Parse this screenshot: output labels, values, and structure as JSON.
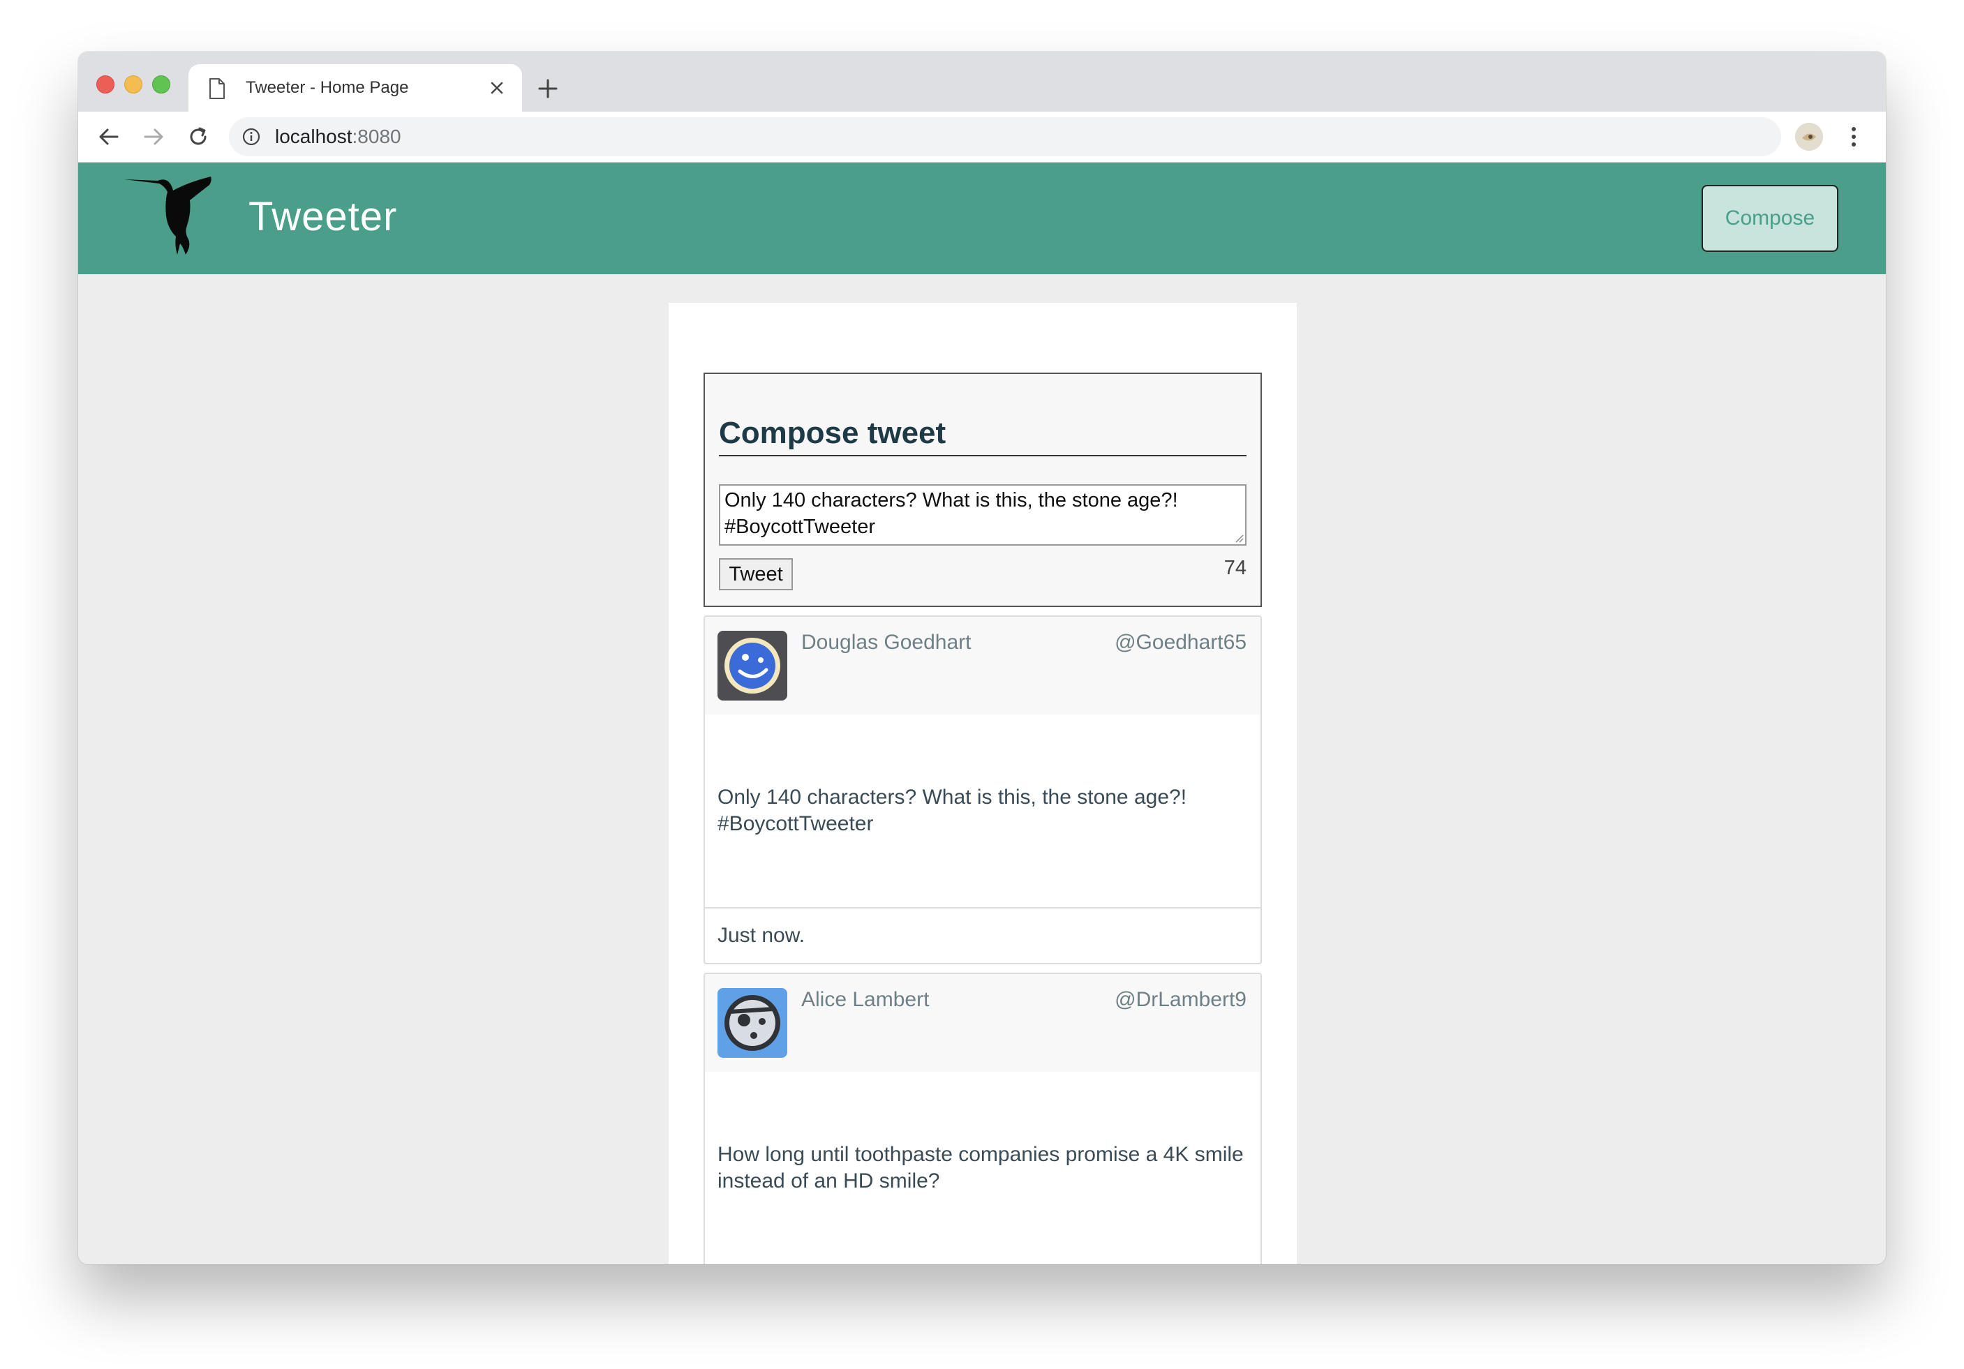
{
  "browser": {
    "tab_title": "Tweeter - Home Page",
    "url_host": "localhost",
    "url_port": ":8080"
  },
  "app": {
    "brand": "Tweeter",
    "compose_button": "Compose"
  },
  "compose": {
    "title": "Compose tweet",
    "text": "Only 140 characters? What is this, the stone age?!\n#BoycottTweeter",
    "button": "Tweet",
    "counter": "74"
  },
  "tweets": [
    {
      "name": "Douglas Goedhart",
      "handle": "@Goedhart65",
      "text": "Only 140 characters? What is this, the stone age?!\n#BoycottTweeter",
      "time": "Just now."
    },
    {
      "name": "Alice Lambert",
      "handle": "@DrLambert9",
      "text": "How long until toothpaste companies promise a 4K smile\ninstead of an HD smile?",
      "time": ""
    }
  ],
  "colors": {
    "header": "#4b9e8a",
    "compose_button_bg": "#c8e4dd",
    "background": "#ededed"
  },
  "icons": [
    "document-icon",
    "close-icon",
    "plus-icon",
    "back-arrow-icon",
    "forward-arrow-icon",
    "reload-icon",
    "info-icon",
    "star-icon",
    "profile-avatar",
    "kebab-menu-icon",
    "hummingbird-logo"
  ]
}
